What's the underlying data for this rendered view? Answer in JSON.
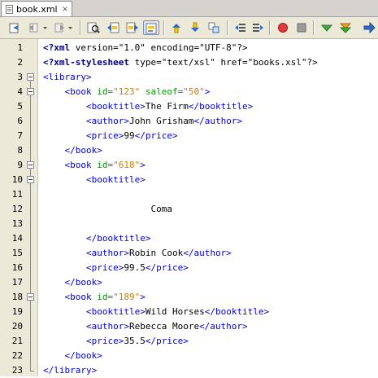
{
  "tab": {
    "label": "book.xml",
    "close": "×"
  },
  "toolbar": {
    "buttons": [
      "last-edit-icon",
      "back-icon",
      "forward-icon",
      "find-icon",
      "find-previous-icon",
      "find-next-icon",
      "toggle-highlight-icon",
      "previous-bookmark-icon",
      "next-bookmark-icon",
      "toggle-bookmark-icon",
      "shift-left-icon",
      "shift-right-icon",
      "start-macro-icon",
      "stop-macro-icon",
      "check-xml-icon",
      "validate-xml-icon",
      "xsl-transform-icon"
    ]
  },
  "lines": [
    {
      "n": "1",
      "tokens": [
        [
          "d",
          "<?"
        ],
        [
          "d",
          "xml"
        ],
        [
          "x",
          " version=\"1.0\" encoding=\"UTF-8\"?>"
        ]
      ]
    },
    {
      "n": "2",
      "tokens": [
        [
          "d",
          "<?"
        ],
        [
          "d",
          "xml-stylesheet"
        ],
        [
          "x",
          " type=\"text/xsl\" href=\"books.xsl\"?>"
        ]
      ]
    },
    {
      "n": "3",
      "tokens": [
        [
          "t",
          "<library>"
        ]
      ]
    },
    {
      "n": "4",
      "tokens": [
        [
          "x",
          "    "
        ],
        [
          "t",
          "<book "
        ],
        [
          "a",
          "id="
        ],
        [
          "v",
          "\"123\""
        ],
        [
          "x",
          " "
        ],
        [
          "a",
          "saleof="
        ],
        [
          "v",
          "\"50\""
        ],
        [
          "t",
          ">"
        ]
      ]
    },
    {
      "n": "5",
      "tokens": [
        [
          "x",
          "        "
        ],
        [
          "t",
          "<booktitle>"
        ],
        [
          "x",
          "The Firm"
        ],
        [
          "t",
          "</booktitle>"
        ]
      ]
    },
    {
      "n": "6",
      "tokens": [
        [
          "x",
          "        "
        ],
        [
          "t",
          "<author>"
        ],
        [
          "x",
          "John Grisham"
        ],
        [
          "t",
          "</author>"
        ]
      ]
    },
    {
      "n": "7",
      "tokens": [
        [
          "x",
          "        "
        ],
        [
          "t",
          "<price>"
        ],
        [
          "x",
          "99"
        ],
        [
          "t",
          "</price>"
        ]
      ]
    },
    {
      "n": "8",
      "tokens": [
        [
          "x",
          "    "
        ],
        [
          "t",
          "</book>"
        ]
      ]
    },
    {
      "n": "9",
      "tokens": [
        [
          "x",
          "    "
        ],
        [
          "t",
          "<book "
        ],
        [
          "a",
          "id="
        ],
        [
          "v",
          "\"618\""
        ],
        [
          "t",
          ">"
        ]
      ]
    },
    {
      "n": "10",
      "tokens": [
        [
          "x",
          "        "
        ],
        [
          "t",
          "<booktitle>"
        ]
      ]
    },
    {
      "n": "11",
      "tokens": []
    },
    {
      "n": "12",
      "tokens": [
        [
          "x",
          "                    Coma"
        ]
      ]
    },
    {
      "n": "13",
      "tokens": []
    },
    {
      "n": "14",
      "tokens": [
        [
          "x",
          "        "
        ],
        [
          "t",
          "</booktitle>"
        ]
      ]
    },
    {
      "n": "15",
      "tokens": [
        [
          "x",
          "        "
        ],
        [
          "t",
          "<author>"
        ],
        [
          "x",
          "Robin Cook"
        ],
        [
          "t",
          "</author>"
        ]
      ]
    },
    {
      "n": "16",
      "tokens": [
        [
          "x",
          "        "
        ],
        [
          "t",
          "<price>"
        ],
        [
          "x",
          "99.5"
        ],
        [
          "t",
          "</price>"
        ]
      ]
    },
    {
      "n": "17",
      "tokens": [
        [
          "x",
          "    "
        ],
        [
          "t",
          "</book>"
        ]
      ]
    },
    {
      "n": "18",
      "tokens": [
        [
          "x",
          "    "
        ],
        [
          "t",
          "<book "
        ],
        [
          "a",
          "id="
        ],
        [
          "v",
          "\"189\""
        ],
        [
          "t",
          ">"
        ]
      ]
    },
    {
      "n": "19",
      "tokens": [
        [
          "x",
          "        "
        ],
        [
          "t",
          "<booktitle>"
        ],
        [
          "x",
          "Wild Horses"
        ],
        [
          "t",
          "</booktitle>"
        ]
      ]
    },
    {
      "n": "20",
      "tokens": [
        [
          "x",
          "        "
        ],
        [
          "t",
          "<author>"
        ],
        [
          "x",
          "Rebecca Moore"
        ],
        [
          "t",
          "</author>"
        ]
      ]
    },
    {
      "n": "21",
      "tokens": [
        [
          "x",
          "        "
        ],
        [
          "t",
          "<price>"
        ],
        [
          "x",
          "35.5"
        ],
        [
          "t",
          "</price>"
        ]
      ]
    },
    {
      "n": "22",
      "tokens": [
        [
          "x",
          "    "
        ],
        [
          "t",
          "</book>"
        ]
      ]
    },
    {
      "n": "23",
      "tokens": [
        [
          "t",
          "</library>"
        ]
      ]
    }
  ],
  "colors": {
    "tag": "#0000e6",
    "declaration": "#000080",
    "attribute": "#009900",
    "attribute_value": "#ce7b00"
  }
}
